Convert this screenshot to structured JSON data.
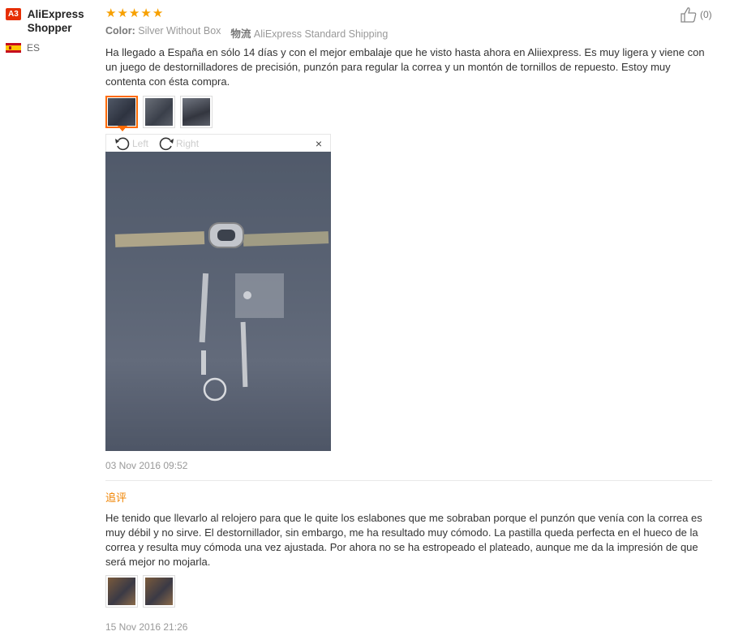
{
  "user": {
    "badge": "A3",
    "name": "AliExpress Shopper",
    "country_code": "ES"
  },
  "review": {
    "stars": 5,
    "color_label": "Color:",
    "color_value": "Silver Without Box",
    "shipping_label": "物流",
    "shipping_value": "AliExpress Standard Shipping",
    "text": "Ha llegado a España en sólo 14 días y con el mejor embalaje que he visto hasta ahora en Aliiexpress. Es muy ligera y viene con un juego de destornilladores de precisión, punzón para regular la correa y un montón de tornillos de repuesto. Estoy muy contenta con ésta compra.",
    "likes": "(0)",
    "date": "03 Nov 2016 09:52"
  },
  "viewer": {
    "left_label": "Left",
    "right_label": "Right",
    "close_symbol": "×"
  },
  "followup": {
    "label": "追评",
    "text": "He tenido que llevarlo al relojero para que le quite los eslabones que me sobraban porque el punzón que venía con la correa es muy débil y no sirve. El destornillador, sin embargo, me ha resultado muy cómodo. La pastilla queda perfecta en el hueco de la correa y resulta muy cómoda una vez ajustada. Por ahora no se ha estropeado el plateado, aunque me da la impresión de que será mejor no mojarla.",
    "date": "15 Nov 2016 21:26"
  },
  "colors": {
    "accent": "#ff6a00",
    "star": "#f7a000",
    "followup_label": "#f08300",
    "badge": "#e62e04"
  }
}
